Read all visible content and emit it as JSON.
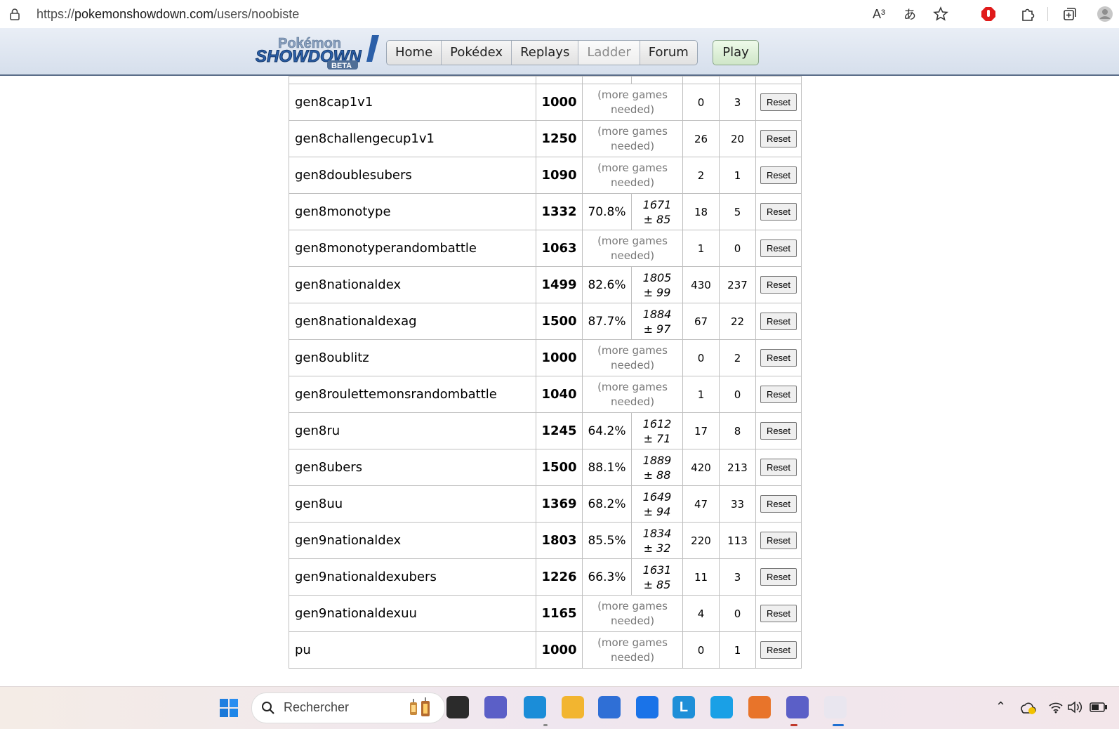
{
  "browser": {
    "url_prefix": "https://",
    "url_domain": "pokemonshowdown.com",
    "url_path": "/users/noobiste",
    "read_aloud_icon": "A³",
    "translate_icon": "あ"
  },
  "header": {
    "logo_top": "Pokémon",
    "logo_main": "SHOWDOWN",
    "logo_badge": "BETA",
    "nav": [
      {
        "label": "Home"
      },
      {
        "label": "Pokédex"
      },
      {
        "label": "Replays"
      },
      {
        "label": "Ladder"
      },
      {
        "label": "Forum"
      }
    ],
    "play_label": "Play"
  },
  "ladder": {
    "reset_label": "Reset",
    "more_games_line1": "(more games",
    "more_games_line2": "needed)",
    "rows": [
      {
        "format": "gen8cap1v1",
        "elo": "1000",
        "gxe": "",
        "glicko": "",
        "glicko_dev": "",
        "w": "0",
        "l": "3"
      },
      {
        "format": "gen8challengecup1v1",
        "elo": "1250",
        "gxe": "",
        "glicko": "",
        "glicko_dev": "",
        "w": "26",
        "l": "20"
      },
      {
        "format": "gen8doublesubers",
        "elo": "1090",
        "gxe": "",
        "glicko": "",
        "glicko_dev": "",
        "w": "2",
        "l": "1"
      },
      {
        "format": "gen8monotype",
        "elo": "1332",
        "gxe": "70.8%",
        "glicko": "1671",
        "glicko_dev": "± 85",
        "w": "18",
        "l": "5"
      },
      {
        "format": "gen8monotyperandombattle",
        "elo": "1063",
        "gxe": "",
        "glicko": "",
        "glicko_dev": "",
        "w": "1",
        "l": "0"
      },
      {
        "format": "gen8nationaldex",
        "elo": "1499",
        "gxe": "82.6%",
        "glicko": "1805",
        "glicko_dev": "± 99",
        "w": "430",
        "l": "237"
      },
      {
        "format": "gen8nationaldexag",
        "elo": "1500",
        "gxe": "87.7%",
        "glicko": "1884",
        "glicko_dev": "± 97",
        "w": "67",
        "l": "22"
      },
      {
        "format": "gen8oublitz",
        "elo": "1000",
        "gxe": "",
        "glicko": "",
        "glicko_dev": "",
        "w": "0",
        "l": "2"
      },
      {
        "format": "gen8roulettemonsrandombattle",
        "elo": "1040",
        "gxe": "",
        "glicko": "",
        "glicko_dev": "",
        "w": "1",
        "l": "0"
      },
      {
        "format": "gen8ru",
        "elo": "1245",
        "gxe": "64.2%",
        "glicko": "1612",
        "glicko_dev": "± 71",
        "w": "17",
        "l": "8"
      },
      {
        "format": "gen8ubers",
        "elo": "1500",
        "gxe": "88.1%",
        "glicko": "1889",
        "glicko_dev": "± 88",
        "w": "420",
        "l": "213"
      },
      {
        "format": "gen8uu",
        "elo": "1369",
        "gxe": "68.2%",
        "glicko": "1649",
        "glicko_dev": "± 94",
        "w": "47",
        "l": "33"
      },
      {
        "format": "gen9nationaldex",
        "elo": "1803",
        "gxe": "85.5%",
        "glicko": "1834",
        "glicko_dev": "± 32",
        "w": "220",
        "l": "113"
      },
      {
        "format": "gen9nationaldexubers",
        "elo": "1226",
        "gxe": "66.3%",
        "glicko": "1631",
        "glicko_dev": "± 85",
        "w": "11",
        "l": "3"
      },
      {
        "format": "gen9nationaldexuu",
        "elo": "1165",
        "gxe": "",
        "glicko": "",
        "glicko_dev": "",
        "w": "4",
        "l": "0"
      },
      {
        "format": "pu",
        "elo": "1000",
        "gxe": "",
        "glicko": "",
        "glicko_dev": "",
        "w": "0",
        "l": "1"
      }
    ]
  },
  "taskbar": {
    "search_placeholder": "Rechercher",
    "apps": [
      {
        "name": "widgets-icon",
        "bg": "#2b2b2b",
        "glyph": ""
      },
      {
        "name": "chat-icon",
        "bg": "#5b5fc7",
        "glyph": ""
      },
      {
        "name": "edge-icon",
        "bg": "#1b8dd8",
        "glyph": ""
      },
      {
        "name": "file-explorer-icon",
        "bg": "#f2b530",
        "glyph": ""
      },
      {
        "name": "store-icon",
        "bg": "#2f6fd6",
        "glyph": ""
      },
      {
        "name": "mail-icon",
        "bg": "#1a73e8",
        "glyph": ""
      },
      {
        "name": "l-app-icon",
        "bg": "#1e8fd8",
        "glyph": "L"
      },
      {
        "name": "alexa-icon",
        "bg": "#1aa0e6",
        "glyph": ""
      },
      {
        "name": "game-app-icon",
        "bg": "#e8742a",
        "glyph": ""
      },
      {
        "name": "teams-icon",
        "bg": "#5b5fc7",
        "glyph": ""
      },
      {
        "name": "snipping-tool-icon",
        "bg": "#e9e6ef",
        "glyph": ""
      }
    ]
  }
}
